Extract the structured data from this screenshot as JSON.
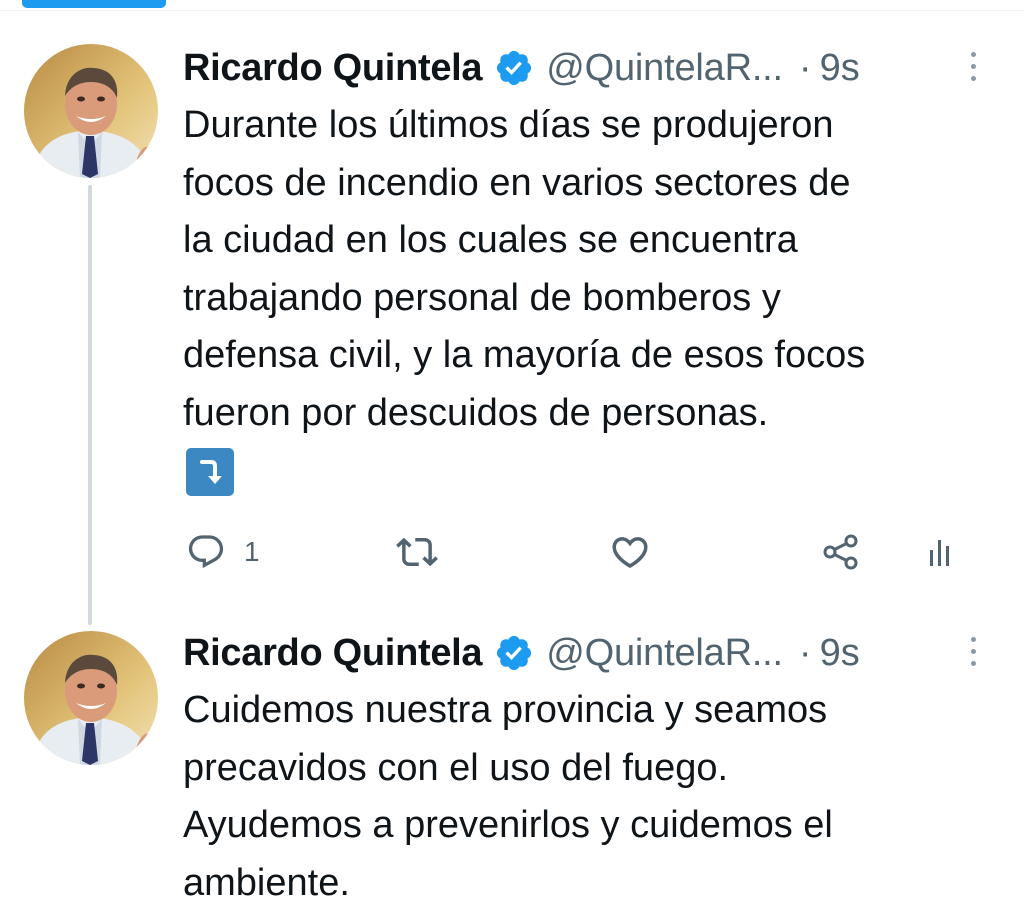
{
  "tweets": [
    {
      "author": "Ricardo Quintela",
      "handle": "@QuintelaR...",
      "separator": "·",
      "time": "9s",
      "text": "Durante los últimos días se produjeron\nfocos de incendio en varios sectores de\nla ciudad en los cuales se encuentra\ntrabajando personal de bomberos y\ndefensa civil, y la mayoría de esos focos\nfueron por descuidos de personas.",
      "emoji": "right-arrow-curving-down-emoji",
      "actions": {
        "reply_icon": "reply-icon",
        "reply_count": "1",
        "retweet_icon": "retweet-icon",
        "like_icon": "heart-icon",
        "share_icon": "share-icon",
        "analytics_icon": "analytics-icon"
      }
    },
    {
      "author": "Ricardo Quintela",
      "handle": "@QuintelaR...",
      "separator": "·",
      "time": "9s",
      "text": "Cuidemos nuestra provincia y seamos\nprecavidos con el uso del fuego.\nAyudemos a prevenirlos y cuidemos el\nambiente."
    }
  ],
  "colors": {
    "accent": "#1d9bf0",
    "text_primary": "#0f1419",
    "text_secondary": "#536471",
    "thread_line": "#cfd9de"
  }
}
